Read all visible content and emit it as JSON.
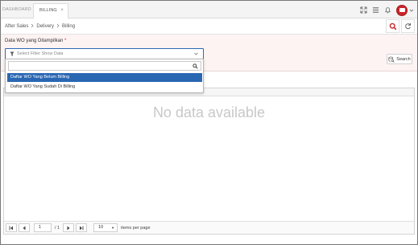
{
  "tabs": [
    {
      "label": "DASHBOARD"
    },
    {
      "label": "BILLING",
      "close": "×"
    }
  ],
  "breadcrumb": [
    "After Sales",
    "Delivery",
    "Billing"
  ],
  "filter": {
    "label": "Data WO yang Ditampilkan",
    "required_mark": "*",
    "placeholder": "Select Filter Show Data",
    "search_button": "Search",
    "options": [
      "Daftar WO Yang Belum Billing",
      "Daftar WO Yang Sudah Di Billing"
    ],
    "selected_index": 0
  },
  "grid": {
    "empty_message": "No data available",
    "pager": {
      "page": "1",
      "of_label": "/ 1",
      "page_size": "10",
      "page_size_suffix": "items per page"
    }
  },
  "colors": {
    "accent": "#2a67b3",
    "brand_red": "#c9252b",
    "filter_bg": "#fdf3f3"
  },
  "icons": {
    "top": [
      "expand-icon",
      "menu-icon",
      "bell-icon",
      "avatar",
      "chevron-down-icon"
    ],
    "crumb_buttons": [
      "search-icon",
      "refresh-icon"
    ]
  }
}
